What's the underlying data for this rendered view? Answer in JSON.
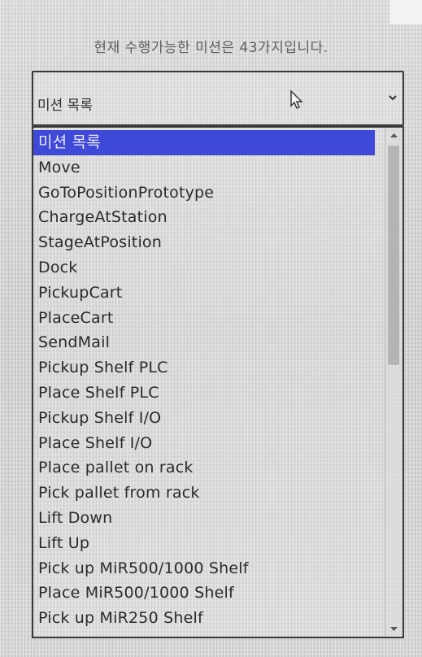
{
  "header": {
    "info_text": "현재 수행가능한 미션은 43가지입니다."
  },
  "mission_dropdown": {
    "selected_value": "미션 목록",
    "arrow_icon": "chevron-down-icon"
  },
  "mission_list": {
    "selected_index": 0,
    "items": [
      "미션 목록",
      "Move",
      "GoToPositionPrototype",
      "ChargeAtStation",
      "StageAtPosition",
      "Dock",
      "PickupCart",
      "PlaceCart",
      "SendMail",
      "Pickup Shelf PLC",
      "Place Shelf PLC",
      "Pickup Shelf I/O",
      "Place Shelf I/O",
      "Place pallet on rack",
      "Pick pallet from rack",
      "Lift Down",
      "Lift Up",
      "Pick up MiR500/1000 Shelf",
      "Place MiR500/1000 Shelf",
      "Pick up MiR250 Shelf"
    ]
  },
  "scrollbar": {
    "position_fraction": 0.0
  },
  "colors": {
    "selection": "#3f49d8",
    "border": "#3a3a3a"
  }
}
